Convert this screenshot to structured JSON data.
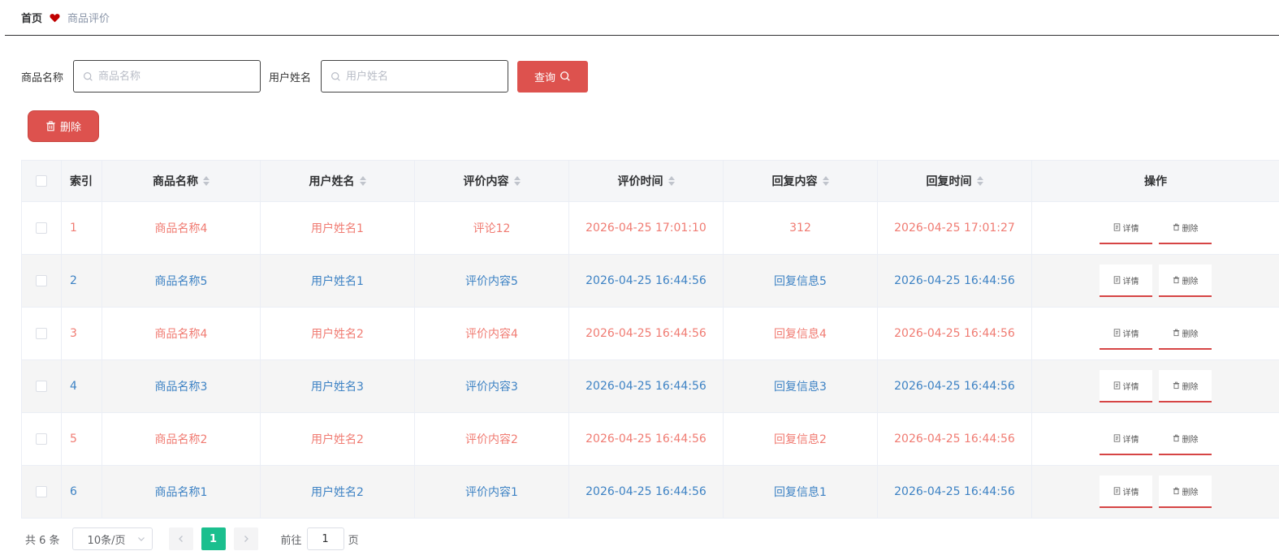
{
  "breadcrumb": {
    "home": "首页",
    "current": "商品评价"
  },
  "search": {
    "goods_label": "商品名称",
    "goods_placeholder": "商品名称",
    "user_label": "用户姓名",
    "user_placeholder": "用户姓名",
    "query_label": "查询"
  },
  "toolbar": {
    "delete_label": "删除"
  },
  "colors": {
    "accent": "#dd524e",
    "odd_text": "#f07b72",
    "even_text": "#3d82c4",
    "page_active": "#1bbf8e"
  },
  "table": {
    "headers": {
      "index": "索引",
      "goods": "商品名称",
      "user": "用户姓名",
      "content": "评价内容",
      "time": "评价时间",
      "reply": "回复内容",
      "reply_time": "回复时间",
      "ops": "操作"
    },
    "detail_label": "详情",
    "delete_label": "删除",
    "rows": [
      {
        "index": "1",
        "goods": "商品名称4",
        "user": "用户姓名1",
        "content": "评论12",
        "time": "2026-04-25 17:01:10",
        "reply": "312",
        "reply_time": "2026-04-25 17:01:27"
      },
      {
        "index": "2",
        "goods": "商品名称5",
        "user": "用户姓名1",
        "content": "评价内容5",
        "time": "2026-04-25 16:44:56",
        "reply": "回复信息5",
        "reply_time": "2026-04-25 16:44:56"
      },
      {
        "index": "3",
        "goods": "商品名称4",
        "user": "用户姓名2",
        "content": "评价内容4",
        "time": "2026-04-25 16:44:56",
        "reply": "回复信息4",
        "reply_time": "2026-04-25 16:44:56"
      },
      {
        "index": "4",
        "goods": "商品名称3",
        "user": "用户姓名3",
        "content": "评价内容3",
        "time": "2026-04-25 16:44:56",
        "reply": "回复信息3",
        "reply_time": "2026-04-25 16:44:56"
      },
      {
        "index": "5",
        "goods": "商品名称2",
        "user": "用户姓名2",
        "content": "评价内容2",
        "time": "2026-04-25 16:44:56",
        "reply": "回复信息2",
        "reply_time": "2026-04-25 16:44:56"
      },
      {
        "index": "6",
        "goods": "商品名称1",
        "user": "用户姓名2",
        "content": "评价内容1",
        "time": "2026-04-25 16:44:56",
        "reply": "回复信息1",
        "reply_time": "2026-04-25 16:44:56"
      }
    ]
  },
  "pagination": {
    "total": "共 6 条",
    "page_size": "10条/页",
    "current_page": "1",
    "goto_prefix": "前往",
    "goto_value": "1",
    "goto_suffix": "页"
  }
}
